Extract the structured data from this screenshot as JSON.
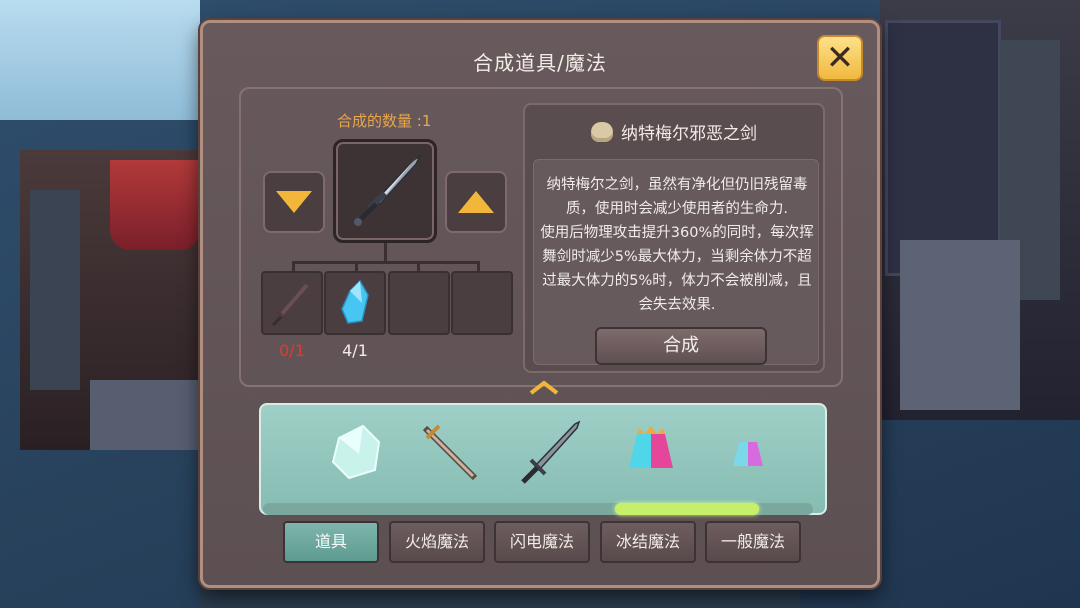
{
  "dialog": {
    "title": "合成道具/魔法",
    "close_label": "✕"
  },
  "craft": {
    "count_label": "合成的数量 :1",
    "materials": [
      {
        "icon": "dark-sword-icon",
        "count": "0/1",
        "count_color": "#e03a2e"
      },
      {
        "icon": "ice-crystal-icon",
        "count": "4/1",
        "count_color": "#f2ece6"
      },
      {
        "icon": "empty-slot",
        "count": ""
      },
      {
        "icon": "empty-slot",
        "count": ""
      }
    ]
  },
  "item": {
    "name": "纳特梅尔邪恶之剑",
    "description": "纳特梅尔之剑，虽然有净化但仍旧残留毒质，使用时会减少使用者的生命力.\n使用后物理攻击提升360%的同时，每次挥舞剑时减少5%最大体力，当剩余体力不超过最大体力的5%时，体力不会被削减，且会失去效果.",
    "craft_button": "合成"
  },
  "strip": {
    "items": [
      "ice-crystal-icon",
      "bronze-sword-icon",
      "dark-sword-icon",
      "pink-cyan-gem-icon",
      "small-gem-icon"
    ],
    "scroll_position": 0.8
  },
  "tabs": [
    {
      "label": "道具",
      "active": true
    },
    {
      "label": "火焰魔法",
      "active": false
    },
    {
      "label": "闪电魔法",
      "active": false
    },
    {
      "label": "冰结魔法",
      "active": false
    },
    {
      "label": "一般魔法",
      "active": false
    }
  ],
  "colors": {
    "accent": "#f2b73a",
    "tab_active": "#6ea89f",
    "insufficient": "#e03a2e"
  }
}
